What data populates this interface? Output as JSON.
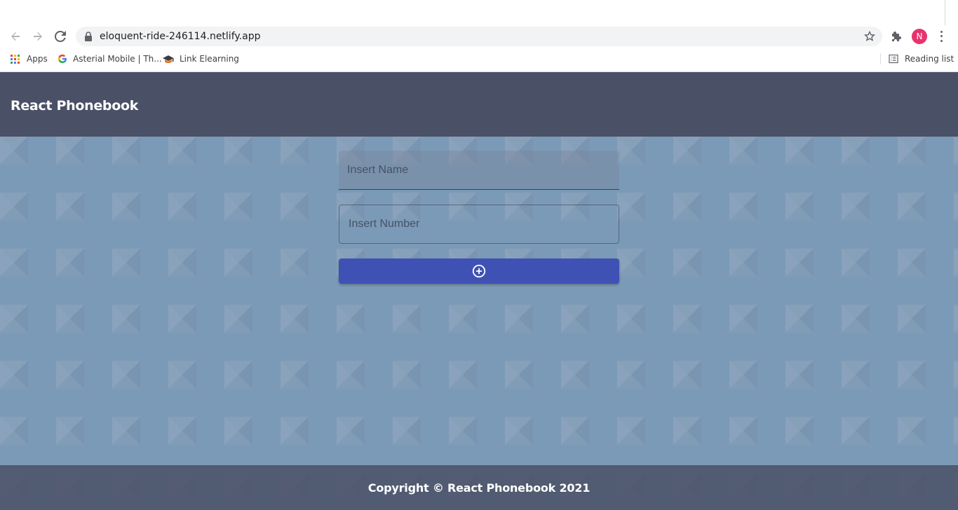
{
  "browser": {
    "url": "eloquent-ride-246114.netlify.app",
    "profile_initial": "N",
    "profile_color": "#e8336e",
    "bookmarks": [
      {
        "label": "Apps",
        "icon": "apps-grid-icon"
      },
      {
        "label": "Asterial Mobile | Th...",
        "icon": "google-icon"
      },
      {
        "label": "Link Elearning",
        "icon": "graduation-cap-icon"
      }
    ],
    "reading_list": "Reading list"
  },
  "app": {
    "title": "React Phonebook",
    "header_color": "#4a5066",
    "form": {
      "name_placeholder": "Insert Name",
      "number_placeholder": "Insert Number",
      "add_button_icon": "add-circle-icon",
      "button_color": "#3f51b5"
    },
    "footer": "Copyright © React Phonebook 2021"
  }
}
